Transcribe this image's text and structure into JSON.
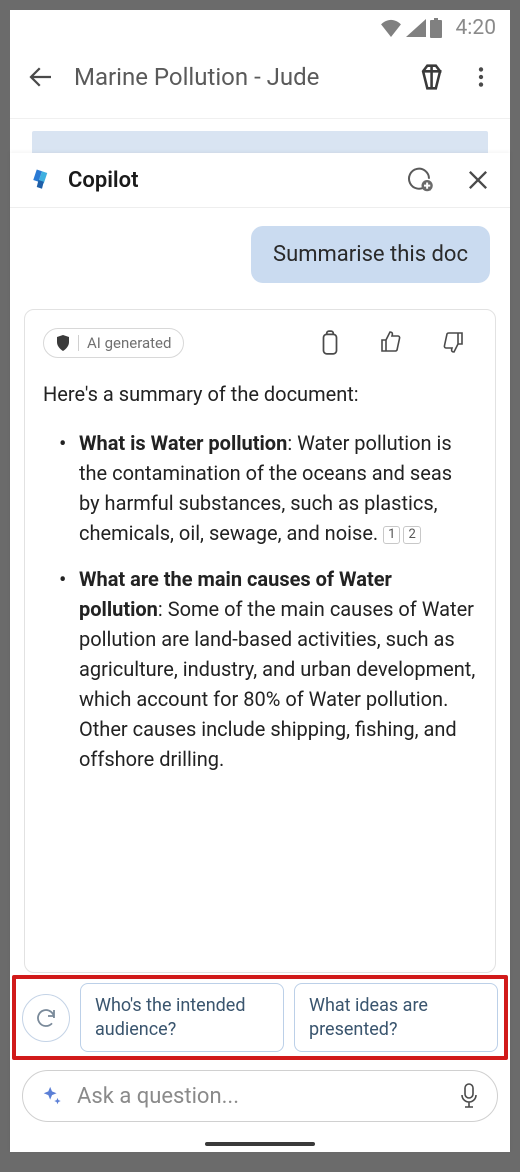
{
  "statusbar": {
    "time": "4:20"
  },
  "appHeader": {
    "title": "Marine Pollution - Jude"
  },
  "copilotPanel": {
    "title": "Copilot"
  },
  "chat": {
    "userMessage": "Summarise this doc",
    "aiBadge": "AI generated",
    "responseIntro": "Here's a summary of the document:",
    "bullets": [
      {
        "title": "What is Water pollution",
        "body": ": Water pollution is the contamination of the oceans and seas by harmful substances, such as plastics, chemicals, oil, sewage, and noise.",
        "citations": [
          "1",
          "2"
        ]
      },
      {
        "title": "What are the main causes of Water pollution",
        "body": ": Some of the main causes of Water pollution are land-based activities, such as agriculture, industry, and urban development, which account for 80% of Water pollution. Other causes include shipping, fishing, and offshore drilling.",
        "citations": []
      }
    ]
  },
  "suggestions": {
    "chip1": "Who's the intended audience?",
    "chip2": "What ideas are presented?"
  },
  "inputBar": {
    "placeholder": "Ask a question..."
  }
}
